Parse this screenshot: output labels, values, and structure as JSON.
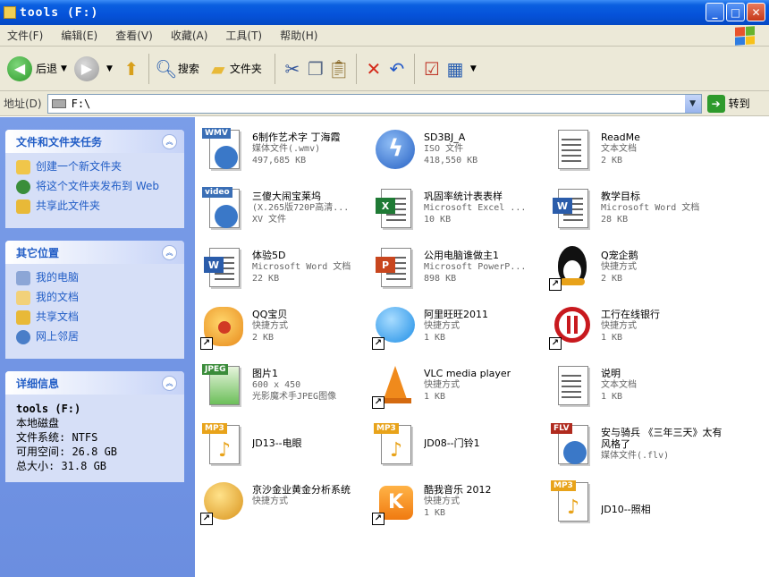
{
  "window": {
    "title": "tools (F:)",
    "buttons": [
      "_",
      "□",
      "✕"
    ]
  },
  "menu": [
    "文件(F)",
    "编辑(E)",
    "查看(V)",
    "收藏(A)",
    "工具(T)",
    "帮助(H)"
  ],
  "toolbar": {
    "back": "后退",
    "search": "搜索",
    "folders": "文件夹"
  },
  "address": {
    "label": "地址(D)",
    "value": "F:\\",
    "go": "转到"
  },
  "tasks_panel": {
    "title": "文件和文件夹任务",
    "items": [
      "创建一个新文件夹",
      "将这个文件夹发布到 Web",
      "共享此文件夹"
    ]
  },
  "places_panel": {
    "title": "其它位置",
    "items": [
      "我的电脑",
      "我的文档",
      "共享文档",
      "网上邻居"
    ]
  },
  "details_panel": {
    "title": "详细信息",
    "name": "tools (F:)",
    "type": "本地磁盘",
    "fs": "文件系统: NTFS",
    "free": "可用空间: 26.8 GB",
    "total": "总大小: 31.8 GB"
  },
  "files": [
    {
      "name": "6制作艺术字 丁海霞",
      "l2": "媒体文件(.wmv)",
      "l3": "497,685 KB",
      "icon": "wmv"
    },
    {
      "name": "SD3BJ_A",
      "l2": "ISO 文件",
      "l3": "418,550 KB",
      "icon": "iso"
    },
    {
      "name": "ReadMe",
      "l2": "文本文档",
      "l3": "2 KB",
      "icon": "txt"
    },
    {
      "name": "三傻大闹宝莱坞",
      "l2": "(X.265版720P高清...",
      "l3": "XV 文件",
      "icon": "video"
    },
    {
      "name": "巩固率统计表表样",
      "l2": "Microsoft Excel ...",
      "l3": "10 KB",
      "icon": "excel"
    },
    {
      "name": "教学目标",
      "l2": "Microsoft Word 文档",
      "l3": "28 KB",
      "icon": "word"
    },
    {
      "name": "体验5D",
      "l2": "Microsoft Word 文档",
      "l3": "22 KB",
      "icon": "word"
    },
    {
      "name": "公用电脑谁做主1",
      "l2": "Microsoft PowerP...",
      "l3": "898 KB",
      "icon": "ppt"
    },
    {
      "name": "Q宠企鹅",
      "l2": "快捷方式",
      "l3": "2 KB",
      "icon": "qq"
    },
    {
      "name": "QQ宝贝",
      "l2": "快捷方式",
      "l3": "2 KB",
      "icon": "qqbaby"
    },
    {
      "name": "阿里旺旺2011",
      "l2": "快捷方式",
      "l3": "1 KB",
      "icon": "ali"
    },
    {
      "name": "工行在线银行",
      "l2": "快捷方式",
      "l3": "1 KB",
      "icon": "icbc"
    },
    {
      "name": "图片1",
      "l2": "600 x 450",
      "l3": "光影魔术手JPEG图像",
      "icon": "jpeg"
    },
    {
      "name": "VLC media player",
      "l2": "快捷方式",
      "l3": "1 KB",
      "icon": "vlc"
    },
    {
      "name": "说明",
      "l2": "文本文档",
      "l3": "1 KB",
      "icon": "txt"
    },
    {
      "name": "JD13--电眼",
      "l2": "",
      "l3": "",
      "icon": "mp3"
    },
    {
      "name": "JD08--门铃1",
      "l2": "",
      "l3": "",
      "icon": "mp3"
    },
    {
      "name": "安与骑兵 《三年三天》太有风格了",
      "l2": "媒体文件(.flv)",
      "l3": "",
      "icon": "flv"
    },
    {
      "name": "京沙金业黄金分析系统",
      "l2": "快捷方式",
      "l3": "",
      "icon": "gold"
    },
    {
      "name": "酷我音乐 2012",
      "l2": "快捷方式",
      "l3": "1 KB",
      "icon": "kuwo"
    },
    {
      "name": "JD10--照相",
      "l2": "",
      "l3": "",
      "icon": "mp3"
    }
  ]
}
